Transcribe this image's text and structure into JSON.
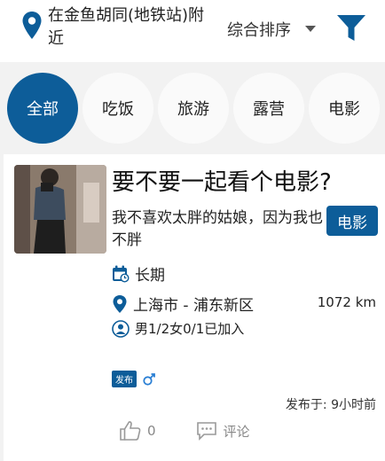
{
  "header": {
    "location": "在金鱼胡同(地铁站)附近",
    "sort_label": "综合排序"
  },
  "categories": [
    {
      "label": "全部",
      "active": true
    },
    {
      "label": "吃饭",
      "active": false
    },
    {
      "label": "旅游",
      "active": false
    },
    {
      "label": "露营",
      "active": false
    },
    {
      "label": "电影",
      "active": false
    }
  ],
  "post": {
    "title": "要不要一起看个电影?",
    "description": "我不喜欢太胖的姑娘，因为我也不胖",
    "tag": "电影",
    "duration": "长期",
    "location": "上海市 - 浦东新区",
    "distance": "1072 km",
    "participants": "男1/2女0/1已加入",
    "badge": "发布",
    "posted": "发布于: 9小时前",
    "likes": "0",
    "comment_label": "评论"
  },
  "colors": {
    "accent": "#0d5d99"
  }
}
